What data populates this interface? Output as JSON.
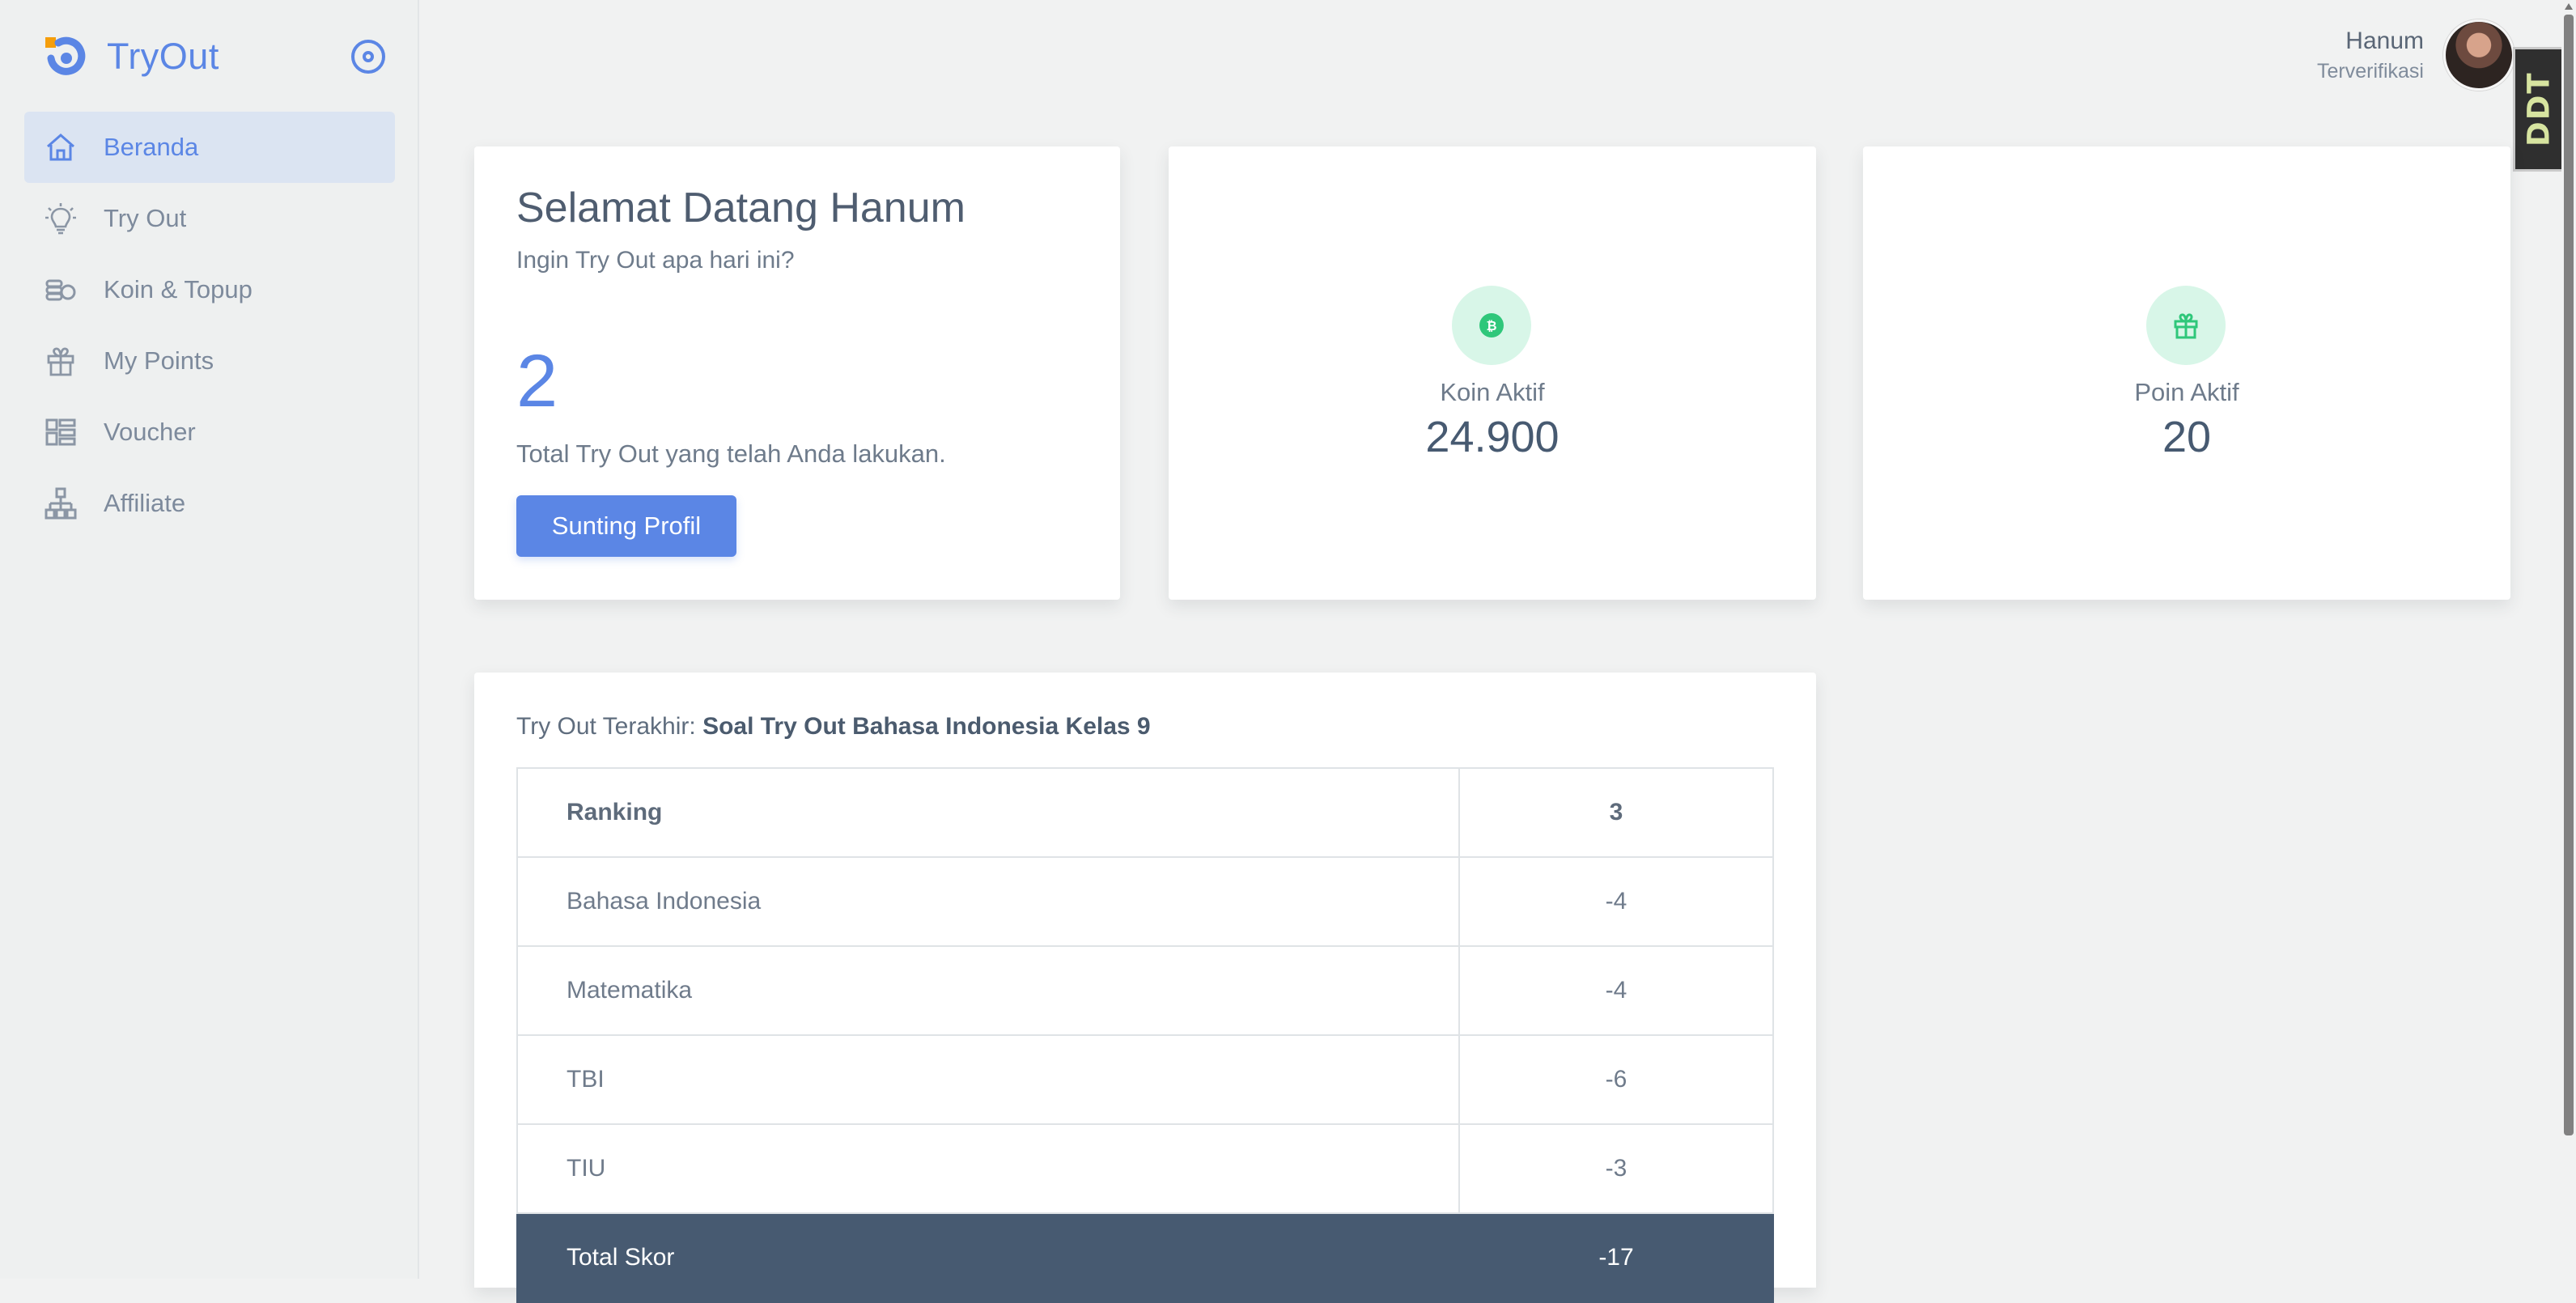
{
  "app": {
    "title": "TryOut",
    "brand_color": "#5b86e5",
    "accent_orange": "#f59e0b"
  },
  "sidebar": {
    "items": [
      {
        "label": "Beranda",
        "icon": "home-icon",
        "active": true
      },
      {
        "label": "Try Out",
        "icon": "lightbulb-icon",
        "active": false
      },
      {
        "label": "Koin & Topup",
        "icon": "coins-icon",
        "active": false
      },
      {
        "label": "My Points",
        "icon": "gift-icon",
        "active": false
      },
      {
        "label": "Voucher",
        "icon": "voucher-grid-icon",
        "active": false
      },
      {
        "label": "Affiliate",
        "icon": "network-icon",
        "active": false
      }
    ]
  },
  "header": {
    "user_name": "Hanum",
    "user_status": "Terverifikasi",
    "side_badge": "DDT"
  },
  "welcome": {
    "title": "Selamat Datang Hanum",
    "subtitle": "Ingin Try Out apa hari ini?",
    "total_tryout": "2",
    "total_label": "Total Try Out yang telah Anda lakukan.",
    "button": "Sunting Profil"
  },
  "stats": {
    "koin": {
      "label": "Koin Aktif",
      "value": "24.900",
      "icon": "bitcoin-icon",
      "icon_color": "#2fc77a"
    },
    "poin": {
      "label": "Poin Aktif",
      "value": "20",
      "icon": "gift-icon",
      "icon_color": "#2fc77a"
    }
  },
  "latest": {
    "prefix": "Try Out Terakhir: ",
    "name": "Soal Try Out Bahasa Indonesia Kelas 9",
    "rows": [
      {
        "label": "Ranking",
        "value": "3",
        "type": "header"
      },
      {
        "label": "Bahasa Indonesia",
        "value": "-4",
        "type": "row"
      },
      {
        "label": "Matematika",
        "value": "-4",
        "type": "row"
      },
      {
        "label": "TBI",
        "value": "-6",
        "type": "row"
      },
      {
        "label": "TIU",
        "value": "-3",
        "type": "row"
      },
      {
        "label": "Total Skor",
        "value": "-17",
        "type": "total"
      }
    ]
  }
}
